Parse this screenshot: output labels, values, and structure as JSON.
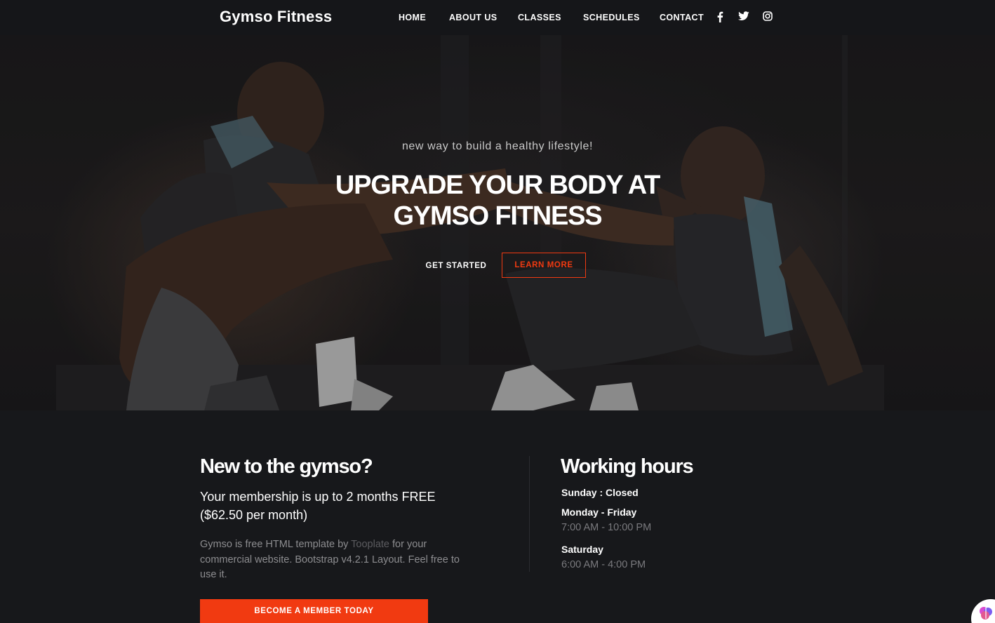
{
  "navbar": {
    "brand": "Gymso Fitness",
    "links": [
      "HOME",
      "ABOUT US",
      "CLASSES",
      "SCHEDULES",
      "CONTACT"
    ],
    "social_icons": [
      "facebook-icon",
      "twitter-icon",
      "instagram-icon"
    ]
  },
  "hero": {
    "subtitle": "new way to build a healthy lifestyle!",
    "title_line1": "UPGRADE YOUR BODY AT",
    "title_line2": "GYMSO FITNESS",
    "primary_button": "GET STARTED",
    "secondary_button": "LEARN MORE"
  },
  "about": {
    "heading": "New to the gymso?",
    "lead_line1": "Your membership is up to 2 months FREE",
    "lead_line2": "($62.50 per month)",
    "desc_before_link": "Gymso is free HTML template by ",
    "desc_link": "Tooplate",
    "desc_after_link": " for your commercial website. Bootstrap v4.2.1 Layout. Feel free to use it.",
    "cta_button": "BECOME A MEMBER TODAY"
  },
  "hours": {
    "heading": "Working hours",
    "sunday": "Sunday : Closed",
    "weekday_label": "Monday - Friday",
    "weekday_time": "7:00 AM - 10:00 PM",
    "saturday_label": "Saturday",
    "saturday_time": "6:00 AM - 4:00 PM"
  },
  "colors": {
    "background": "#17181b",
    "accent": "#f13a11",
    "muted_text": "#8d8d90"
  }
}
